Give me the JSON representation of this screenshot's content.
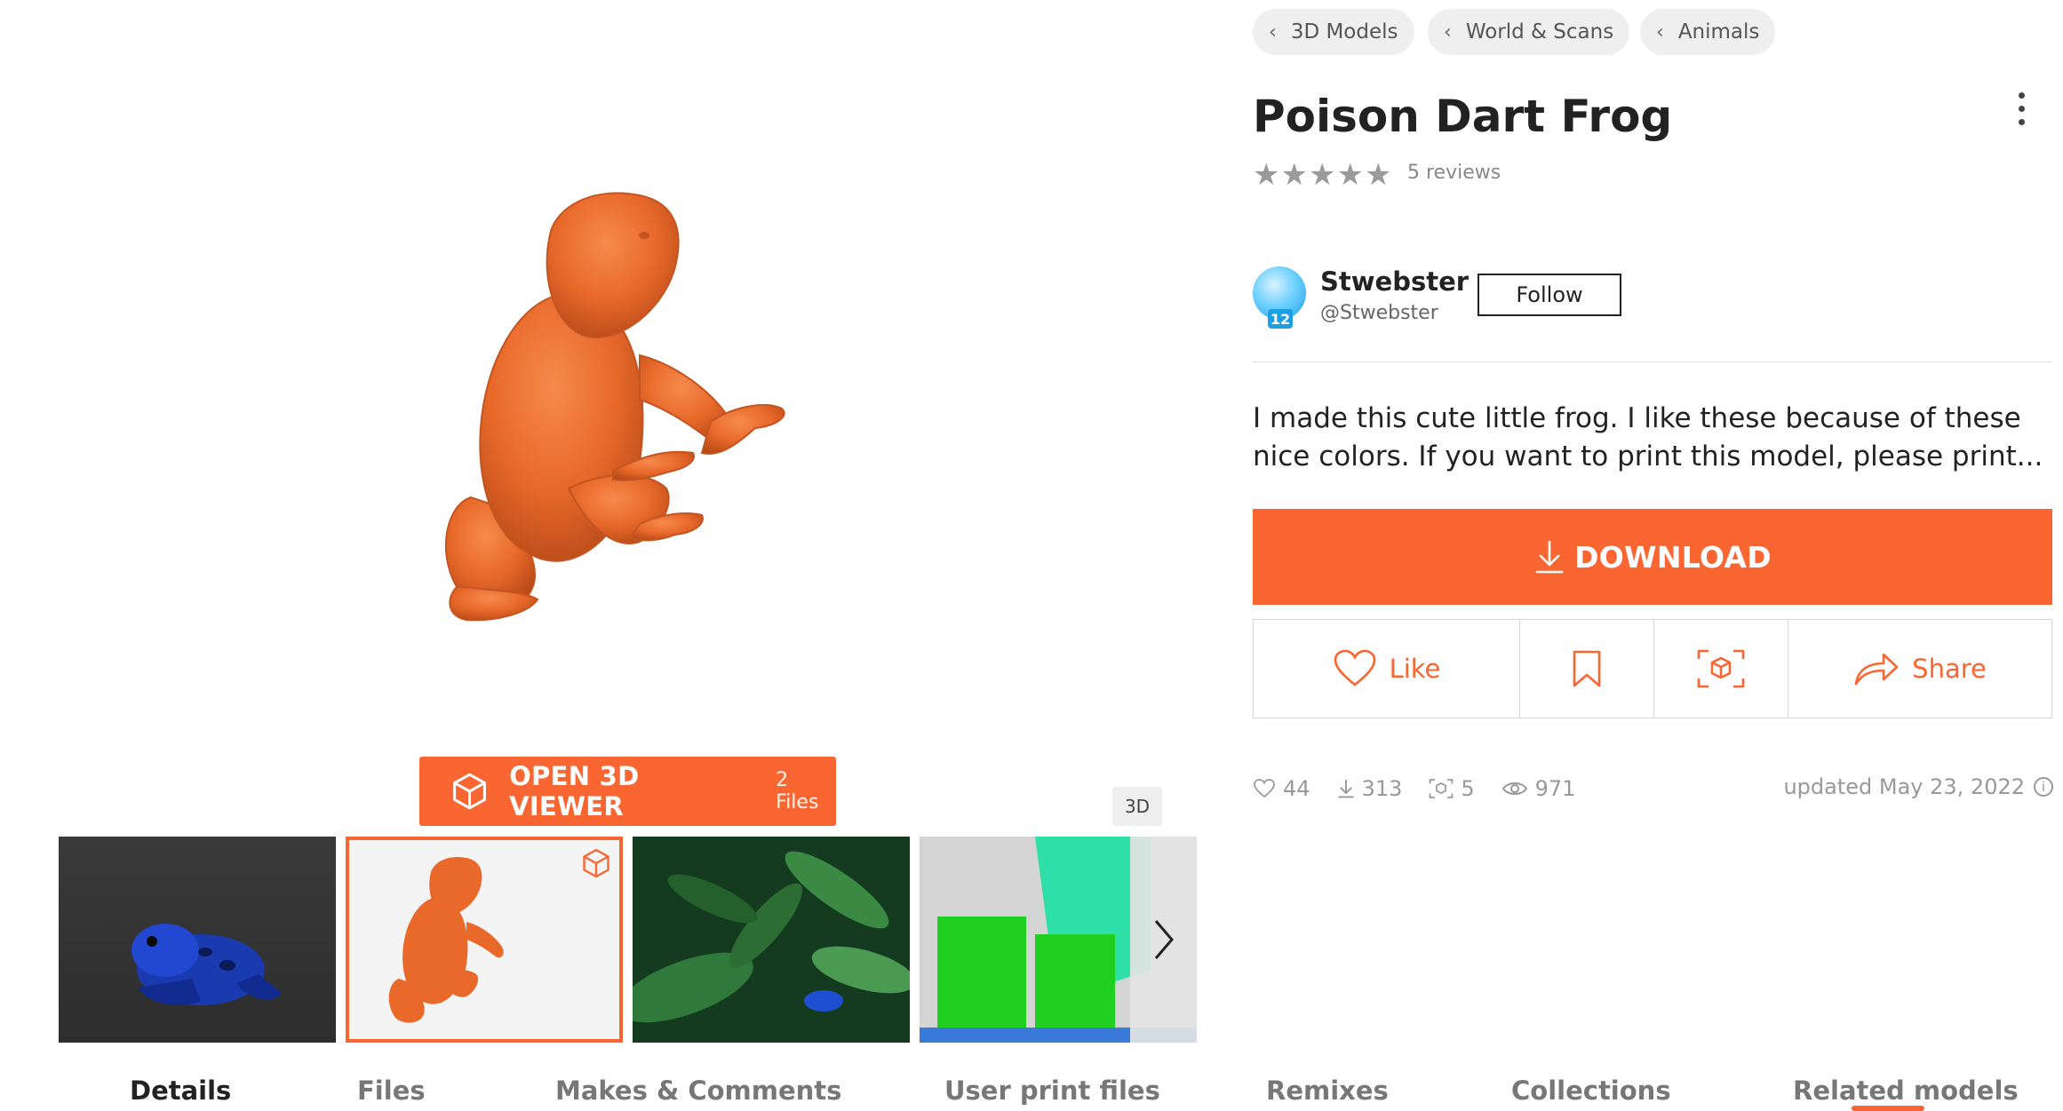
{
  "breadcrumbs": [
    {
      "label": "3D Models"
    },
    {
      "label": "World & Scans"
    },
    {
      "label": "Animals"
    }
  ],
  "model": {
    "title": "Poison Dart Frog",
    "rating_stars": 5,
    "reviews": "5 reviews",
    "description": "I made this cute little frog. I like these because of these nice colors. If you want to print this model, please print..."
  },
  "author": {
    "name": "Stwebster",
    "handle": "@Stwebster",
    "level": "12",
    "follow_label": "Follow"
  },
  "viewer": {
    "open_label": "OPEN 3D VIEWER",
    "files_label": "2 Files",
    "badge": "3D"
  },
  "actions": {
    "download_label": "DOWNLOAD",
    "like_label": "Like",
    "share_label": "Share"
  },
  "stats": {
    "likes": "44",
    "downloads": "313",
    "makes": "5",
    "views": "971",
    "updated": "updated May 23, 2022"
  },
  "tabs": [
    {
      "label": "Details"
    },
    {
      "label": "Files"
    },
    {
      "label": "Makes & Comments"
    },
    {
      "label": "User print files"
    },
    {
      "label": "Remixes"
    },
    {
      "label": "Collections"
    },
    {
      "label": "Related models"
    }
  ],
  "colors": {
    "accent": "#f96632",
    "model_orange": "#e8692a"
  },
  "icons": [
    "chevron-left-icon",
    "more-vertical-icon",
    "star-icon",
    "cube-icon",
    "download-icon",
    "heart-icon",
    "bookmark-icon",
    "ar-cube-icon",
    "share-icon",
    "eye-icon",
    "info-icon",
    "chevron-right-icon"
  ]
}
